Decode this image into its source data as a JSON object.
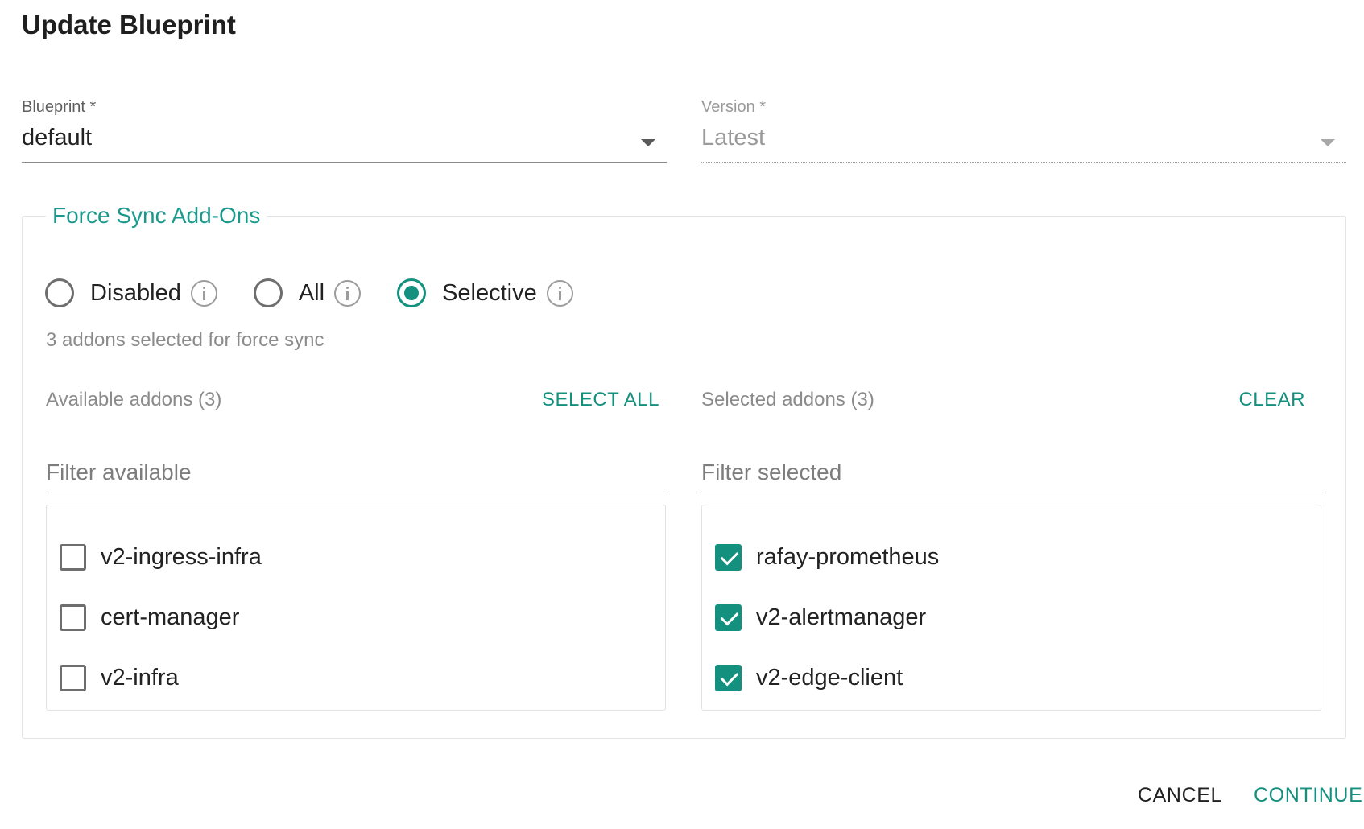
{
  "dialog": {
    "title": "Update Blueprint"
  },
  "blueprint": {
    "label": "Blueprint *",
    "value": "default"
  },
  "version": {
    "label": "Version *",
    "value": "Latest",
    "disabled": true
  },
  "force_sync": {
    "legend": "Force Sync Add-Ons",
    "options": [
      {
        "label": "Disabled",
        "checked": false
      },
      {
        "label": "All",
        "checked": false
      },
      {
        "label": "Selective",
        "checked": true
      }
    ],
    "summary": "3 addons selected for force sync",
    "available": {
      "title": "Available addons (3)",
      "action": "SELECT ALL",
      "filter_placeholder": "Filter available",
      "items": [
        {
          "label": "v2-ingress-infra",
          "checked": false
        },
        {
          "label": "cert-manager",
          "checked": false
        },
        {
          "label": "v2-infra",
          "checked": false
        }
      ]
    },
    "selected": {
      "title": "Selected addons (3)",
      "action": "CLEAR",
      "filter_placeholder": "Filter selected",
      "items": [
        {
          "label": "rafay-prometheus",
          "checked": true
        },
        {
          "label": "v2-alertmanager",
          "checked": true
        },
        {
          "label": "v2-edge-client",
          "checked": true
        }
      ]
    }
  },
  "footer": {
    "cancel_label": "CANCEL",
    "continue_label": "CONTINUE"
  },
  "colors": {
    "accent": "#14907f",
    "legend": "#1a9a8c",
    "muted_text": "#8b8b8b"
  },
  "icons": {
    "info": "info-circle-icon",
    "dropdown": "caret-down-icon",
    "check": "checkmark-icon"
  }
}
